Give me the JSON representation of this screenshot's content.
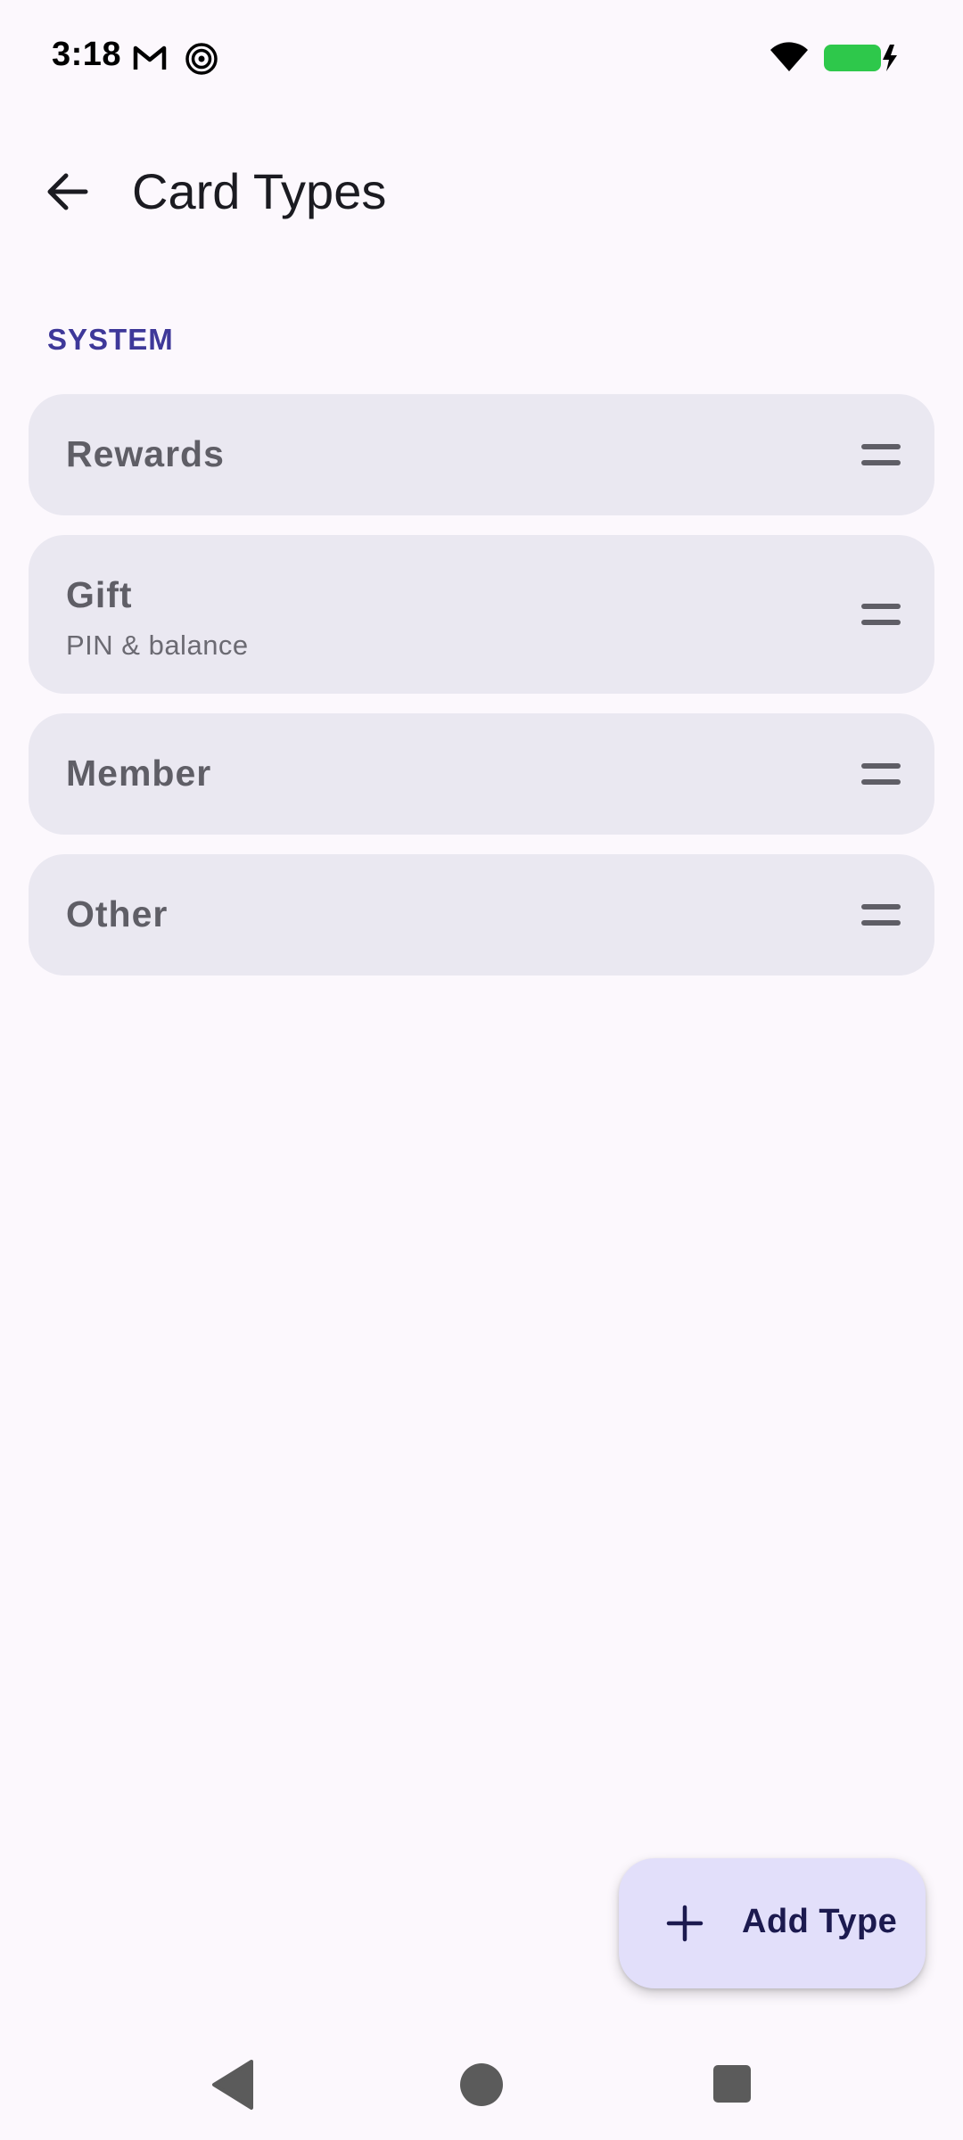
{
  "status_bar": {
    "time": "3:18",
    "icons": [
      "gmail-icon",
      "target-icon",
      "wifi-icon",
      "battery-charging-icon"
    ],
    "battery_color": "#2EC84B"
  },
  "app_bar": {
    "title": "Card Types",
    "back_icon": "arrow-back-icon"
  },
  "section": {
    "header": "SYSTEM",
    "header_color": "#3E3899"
  },
  "card_types": [
    {
      "label": "Rewards",
      "sublabel": ""
    },
    {
      "label": "Gift",
      "sublabel": "PIN & balance"
    },
    {
      "label": "Member",
      "sublabel": ""
    },
    {
      "label": "Other",
      "sublabel": ""
    }
  ],
  "fab": {
    "label": "Add Type",
    "icon": "plus-icon",
    "background": "#E2DFFA"
  },
  "nav_bar": {
    "icons": [
      "nav-back-icon",
      "nav-home-icon",
      "nav-recents-icon"
    ]
  }
}
